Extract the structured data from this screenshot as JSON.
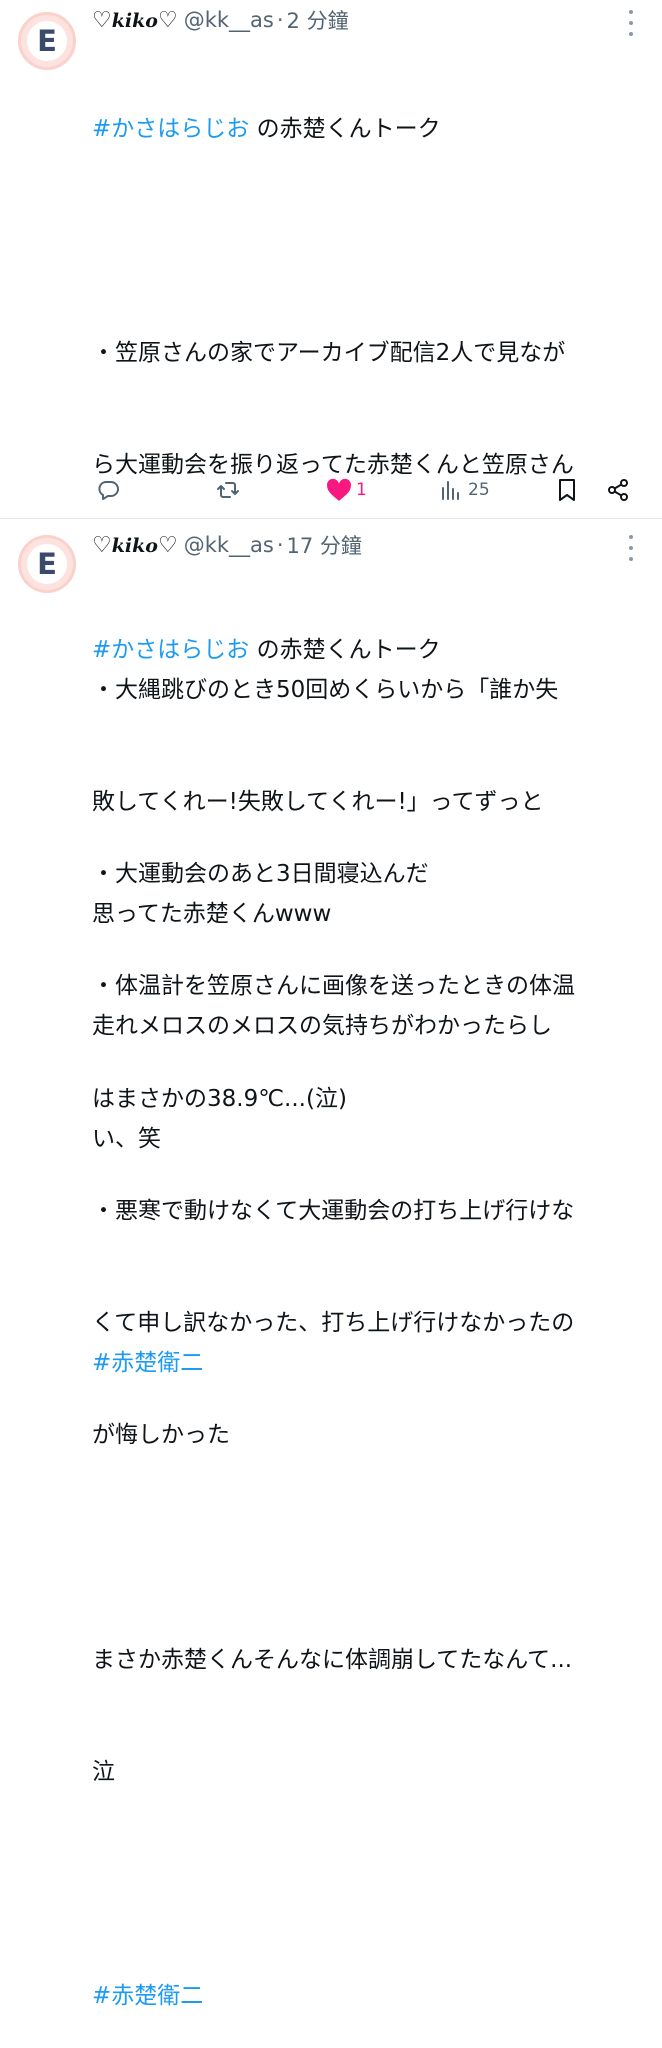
{
  "tweets": [
    {
      "avatar_letter": "E",
      "display_name_prefix": "♡",
      "display_name_main": "kiko",
      "display_name_suffix": "♡",
      "handle": "@kk__as",
      "separator": "·",
      "time": "2 分鐘",
      "lines": [
        {
          "hashtag": "#かさはらじお",
          "text": " の赤楚くんトーク"
        },
        {
          "text": ""
        },
        {
          "text": "・笠原さんの家でアーカイブ配信2人で見なが"
        },
        {
          "text": "ら大運動会を振り返ってた赤楚くんと笠原さん"
        },
        {
          "text": ""
        },
        {
          "text": "・大縄跳びのとき50回めくらいから「誰か失"
        },
        {
          "text": "敗してくれー!失敗してくれー!」ってずっと"
        },
        {
          "text": "思ってた赤楚くんwww"
        },
        {
          "text": "走れメロスのメロスの気持ちがわかったらし"
        },
        {
          "text": "い、笑"
        },
        {
          "text": ""
        },
        {
          "hashtag": "#赤楚衛二",
          "text": ""
        }
      ],
      "actions": {
        "reply_count": "",
        "retweet_count": "",
        "like_count": "1",
        "views_count": "25"
      },
      "icons": {
        "reply": "reply-icon",
        "retweet": "retweet-icon",
        "like": "heart-icon",
        "views": "views-icon",
        "bookmark": "bookmark-icon",
        "share": "share-icon",
        "more": "more-icon"
      }
    },
    {
      "avatar_letter": "E",
      "display_name_prefix": "♡",
      "display_name_main": "kiko",
      "display_name_suffix": "♡",
      "handle": "@kk__as",
      "separator": "·",
      "time": "17 分鐘",
      "lines": [
        {
          "hashtag": "#かさはらじお",
          "text": " の赤楚くんトーク"
        },
        {
          "text": ""
        },
        {
          "text": "・大運動会のあと3日間寝込んだ"
        },
        {
          "text": "・体温計を笠原さんに画像を送ったときの体温"
        },
        {
          "text": "はまさかの38.9℃...(泣)"
        },
        {
          "text": "・悪寒で動けなくて大運動会の打ち上げ行けな"
        },
        {
          "text": "くて申し訳なかった、打ち上げ行けなかったの"
        },
        {
          "text": "が悔しかった"
        },
        {
          "text": ""
        },
        {
          "text": "まさか赤楚くんそんなに体調崩してたなんて..."
        },
        {
          "text": "泣"
        },
        {
          "text": ""
        },
        {
          "hashtag": "#赤楚衛二",
          "text": ""
        }
      ]
    }
  ],
  "colors": {
    "accent": "#1d9bf0",
    "like": "#f91880",
    "muted": "#536471",
    "text": "#0f1419",
    "avatar_bg": "#fde3df"
  }
}
